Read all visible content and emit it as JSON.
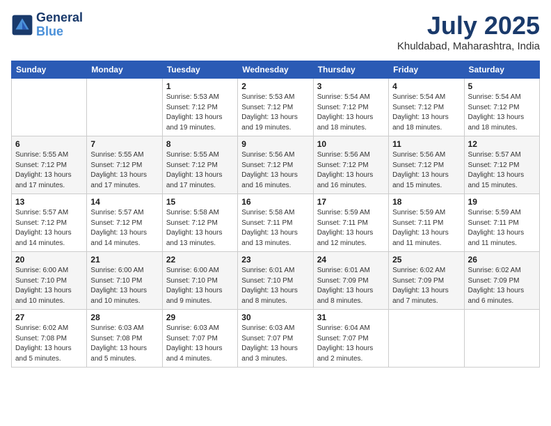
{
  "header": {
    "logo_line1": "General",
    "logo_line2": "Blue",
    "month": "July 2025",
    "location": "Khuldabad, Maharashtra, India"
  },
  "weekdays": [
    "Sunday",
    "Monday",
    "Tuesday",
    "Wednesday",
    "Thursday",
    "Friday",
    "Saturday"
  ],
  "weeks": [
    [
      {
        "day": "",
        "info": ""
      },
      {
        "day": "",
        "info": ""
      },
      {
        "day": "1",
        "info": "Sunrise: 5:53 AM\nSunset: 7:12 PM\nDaylight: 13 hours and 19 minutes."
      },
      {
        "day": "2",
        "info": "Sunrise: 5:53 AM\nSunset: 7:12 PM\nDaylight: 13 hours and 19 minutes."
      },
      {
        "day": "3",
        "info": "Sunrise: 5:54 AM\nSunset: 7:12 PM\nDaylight: 13 hours and 18 minutes."
      },
      {
        "day": "4",
        "info": "Sunrise: 5:54 AM\nSunset: 7:12 PM\nDaylight: 13 hours and 18 minutes."
      },
      {
        "day": "5",
        "info": "Sunrise: 5:54 AM\nSunset: 7:12 PM\nDaylight: 13 hours and 18 minutes."
      }
    ],
    [
      {
        "day": "6",
        "info": "Sunrise: 5:55 AM\nSunset: 7:12 PM\nDaylight: 13 hours and 17 minutes."
      },
      {
        "day": "7",
        "info": "Sunrise: 5:55 AM\nSunset: 7:12 PM\nDaylight: 13 hours and 17 minutes."
      },
      {
        "day": "8",
        "info": "Sunrise: 5:55 AM\nSunset: 7:12 PM\nDaylight: 13 hours and 17 minutes."
      },
      {
        "day": "9",
        "info": "Sunrise: 5:56 AM\nSunset: 7:12 PM\nDaylight: 13 hours and 16 minutes."
      },
      {
        "day": "10",
        "info": "Sunrise: 5:56 AM\nSunset: 7:12 PM\nDaylight: 13 hours and 16 minutes."
      },
      {
        "day": "11",
        "info": "Sunrise: 5:56 AM\nSunset: 7:12 PM\nDaylight: 13 hours and 15 minutes."
      },
      {
        "day": "12",
        "info": "Sunrise: 5:57 AM\nSunset: 7:12 PM\nDaylight: 13 hours and 15 minutes."
      }
    ],
    [
      {
        "day": "13",
        "info": "Sunrise: 5:57 AM\nSunset: 7:12 PM\nDaylight: 13 hours and 14 minutes."
      },
      {
        "day": "14",
        "info": "Sunrise: 5:57 AM\nSunset: 7:12 PM\nDaylight: 13 hours and 14 minutes."
      },
      {
        "day": "15",
        "info": "Sunrise: 5:58 AM\nSunset: 7:12 PM\nDaylight: 13 hours and 13 minutes."
      },
      {
        "day": "16",
        "info": "Sunrise: 5:58 AM\nSunset: 7:11 PM\nDaylight: 13 hours and 13 minutes."
      },
      {
        "day": "17",
        "info": "Sunrise: 5:59 AM\nSunset: 7:11 PM\nDaylight: 13 hours and 12 minutes."
      },
      {
        "day": "18",
        "info": "Sunrise: 5:59 AM\nSunset: 7:11 PM\nDaylight: 13 hours and 11 minutes."
      },
      {
        "day": "19",
        "info": "Sunrise: 5:59 AM\nSunset: 7:11 PM\nDaylight: 13 hours and 11 minutes."
      }
    ],
    [
      {
        "day": "20",
        "info": "Sunrise: 6:00 AM\nSunset: 7:10 PM\nDaylight: 13 hours and 10 minutes."
      },
      {
        "day": "21",
        "info": "Sunrise: 6:00 AM\nSunset: 7:10 PM\nDaylight: 13 hours and 10 minutes."
      },
      {
        "day": "22",
        "info": "Sunrise: 6:00 AM\nSunset: 7:10 PM\nDaylight: 13 hours and 9 minutes."
      },
      {
        "day": "23",
        "info": "Sunrise: 6:01 AM\nSunset: 7:10 PM\nDaylight: 13 hours and 8 minutes."
      },
      {
        "day": "24",
        "info": "Sunrise: 6:01 AM\nSunset: 7:09 PM\nDaylight: 13 hours and 8 minutes."
      },
      {
        "day": "25",
        "info": "Sunrise: 6:02 AM\nSunset: 7:09 PM\nDaylight: 13 hours and 7 minutes."
      },
      {
        "day": "26",
        "info": "Sunrise: 6:02 AM\nSunset: 7:09 PM\nDaylight: 13 hours and 6 minutes."
      }
    ],
    [
      {
        "day": "27",
        "info": "Sunrise: 6:02 AM\nSunset: 7:08 PM\nDaylight: 13 hours and 5 minutes."
      },
      {
        "day": "28",
        "info": "Sunrise: 6:03 AM\nSunset: 7:08 PM\nDaylight: 13 hours and 5 minutes."
      },
      {
        "day": "29",
        "info": "Sunrise: 6:03 AM\nSunset: 7:07 PM\nDaylight: 13 hours and 4 minutes."
      },
      {
        "day": "30",
        "info": "Sunrise: 6:03 AM\nSunset: 7:07 PM\nDaylight: 13 hours and 3 minutes."
      },
      {
        "day": "31",
        "info": "Sunrise: 6:04 AM\nSunset: 7:07 PM\nDaylight: 13 hours and 2 minutes."
      },
      {
        "day": "",
        "info": ""
      },
      {
        "day": "",
        "info": ""
      }
    ]
  ]
}
